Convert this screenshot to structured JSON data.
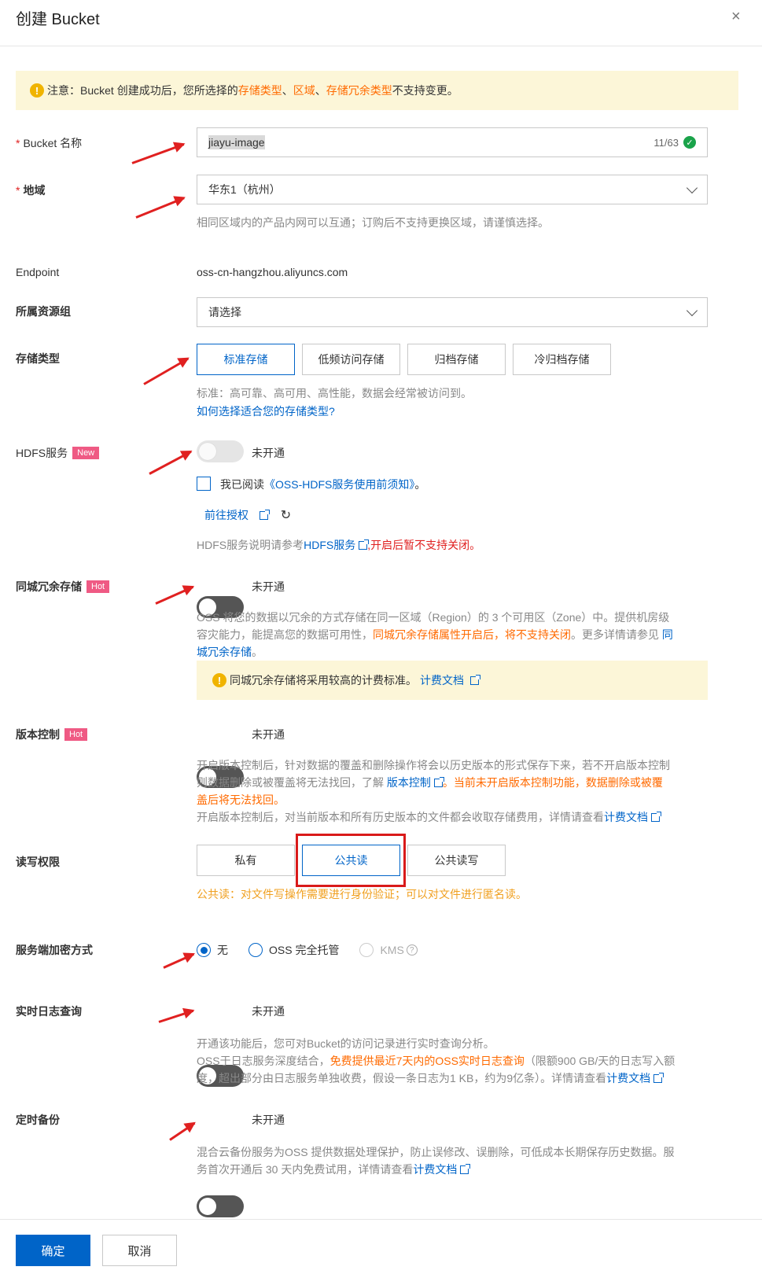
{
  "header": {
    "title": "创建 Bucket",
    "close": "×"
  },
  "notice": {
    "prefix": "注意：Bucket 创建成功后，您所选择的 ",
    "link1": "存储类型",
    "sep1": "、",
    "link2": "区域",
    "sep2": "、",
    "link3": "存储冗余类型",
    "suffix": " 不支持变更。"
  },
  "bucket_name": {
    "label": "Bucket 名称",
    "value": "jiayu-image",
    "counter": "11/63"
  },
  "region": {
    "label": "地域",
    "value": "华东1（杭州）",
    "help": "相同区域内的产品内网可以互通；订购后不支持更换区域，请谨慎选择。"
  },
  "endpoint": {
    "label": "Endpoint",
    "value": "oss-cn-hangzhou.aliyuncs.com"
  },
  "resource_group": {
    "label": "所属资源组",
    "placeholder": "请选择"
  },
  "storage_type": {
    "label": "存储类型",
    "options": [
      "标准存储",
      "低频访问存储",
      "归档存储",
      "冷归档存储"
    ],
    "help": "标准：高可靠、高可用、高性能，数据会经常被访问到。",
    "link": "如何选择适合您的存储类型?"
  },
  "hdfs": {
    "label": "HDFS服务",
    "tag": "New",
    "status": "未开通",
    "agree_prefix": "我已阅读",
    "agree_link": "《OSS-HDFS服务使用前须知》",
    "agree_suffix": "。",
    "authorize": "前往授权",
    "note_prefix": "HDFS服务说明请参考",
    "note_link": "HDFS服务",
    "note_warn": ",开启后暂不支持关闭。"
  },
  "zrs": {
    "label": "同城冗余存储",
    "tag": "Hot",
    "status": "未开通",
    "desc1": "OSS 将您的数据以冗余的方式存储在同一区域（Region）的 3 个可用区（Zone）中。提供机房级",
    "desc2a": "容灾能力，能提高您的数据可用性，",
    "desc2b": "同城冗余存储属性开启后，将不支持关闭",
    "desc2c": "。更多详情请参见 ",
    "desc2link": "同",
    "desc3link": "城冗余存储",
    "desc3c": "。",
    "note": "同城冗余存储将采用较高的计费标准。",
    "note_link": "计费文档"
  },
  "versioning": {
    "label": "版本控制",
    "tag": "Hot",
    "status": "未开通",
    "desc1": "开启版本控制后，针对数据的覆盖和删除操作将会以历史版本的形式保存下来，若不开启版本控制",
    "desc2a": "则数据删除或被覆盖将无法找回，了解 ",
    "desc2link": "版本控制",
    "desc2b": "。当前未开启版本控制功能，数据删除或被覆",
    "desc3": "盖后将无法找回。",
    "desc4": "开启版本控制后，对当前版本和所有历史版本的文件都会收取存储费用，详情请查看",
    "desc4link": "计费文档"
  },
  "acl": {
    "label": "读写权限",
    "options": [
      "私有",
      "公共读",
      "公共读写"
    ],
    "help": "公共读：对文件写操作需要进行身份验证；可以对文件进行匿名读。"
  },
  "encryption": {
    "label": "服务端加密方式",
    "options": [
      "无",
      "OSS 完全托管",
      "KMS"
    ]
  },
  "realtime_log": {
    "label": "实时日志查询",
    "status": "未开通",
    "desc1": "开通该功能后，您可对Bucket的访问记录进行实时查询分析。",
    "desc2a": "OSS于日志服务深度结合，",
    "desc2b": "免费提供最近7天内的OSS实时日志查询",
    "desc2c": "（限额900 GB/天的日志写入额",
    "desc3": "度，超出部分由日志服务单独收费，假设一条日志为1 KB，约为9亿条）。详情请查看",
    "desc3link": "计费文档"
  },
  "backup": {
    "label": "定时备份",
    "status": "未开通",
    "desc1": "混合云备份服务为OSS 提供数据处理保护，防止误修改、误删除，可低成本长期保存历史数据。服",
    "desc2": "务首次开通后 30 天内免费试用，详情请查看",
    "desc2link": "计费文档"
  },
  "footer": {
    "confirm": "确定",
    "cancel": "取消"
  },
  "colors": {
    "primary": "#0064c8",
    "warning": "#ff6a00",
    "danger": "#e02020",
    "notice_bg": "#fcf6d8"
  }
}
